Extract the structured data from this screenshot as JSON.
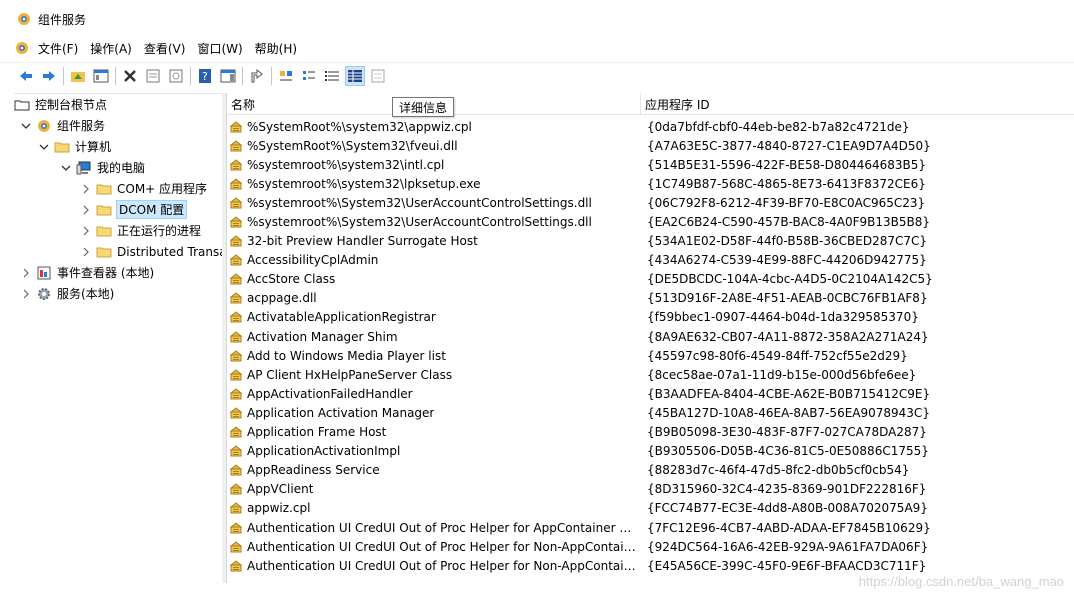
{
  "window": {
    "title": "组件服务"
  },
  "menu": {
    "items": [
      "文件(F)",
      "操作(A)",
      "查看(V)",
      "窗口(W)",
      "帮助(H)"
    ]
  },
  "tooltip": {
    "text": "详细信息"
  },
  "tree": {
    "items": [
      {
        "label": "控制台根节点"
      },
      {
        "label": "组件服务"
      },
      {
        "label": "计算机"
      },
      {
        "label": "我的电脑"
      },
      {
        "label": "COM+ 应用程序"
      },
      {
        "label": "DCOM 配置"
      },
      {
        "label": "正在运行的进程"
      },
      {
        "label": "Distributed Transaction Coordinator"
      },
      {
        "label": "事件查看器 (本地)"
      },
      {
        "label": "服务(本地)"
      }
    ]
  },
  "list": {
    "columns": {
      "name": "名称",
      "appid": "应用程序 ID"
    },
    "rows": [
      {
        "name": "%SystemRoot%\\system32\\appwiz.cpl",
        "appid": "{0da7bfdf-cbf0-44eb-be82-b7a82c4721de}"
      },
      {
        "name": "%SystemRoot%\\System32\\fveui.dll",
        "appid": "{A7A63E5C-3877-4840-8727-C1EA9D7A4D50}"
      },
      {
        "name": "%systemroot%\\system32\\intl.cpl",
        "appid": "{514B5E31-5596-422F-BE58-D804464683B5}"
      },
      {
        "name": "%systemroot%\\system32\\lpksetup.exe",
        "appid": "{1C749B87-568C-4865-8E73-6413F8372CE6}"
      },
      {
        "name": "%systemroot%\\System32\\UserAccountControlSettings.dll",
        "appid": "{06C792F8-6212-4F39-BF70-E8C0AC965C23}"
      },
      {
        "name": "%systemroot%\\System32\\UserAccountControlSettings.dll",
        "appid": "{EA2C6B24-C590-457B-BAC8-4A0F9B13B5B8}"
      },
      {
        "name": "32-bit Preview Handler Surrogate Host",
        "appid": "{534A1E02-D58F-44f0-B58B-36CBED287C7C}"
      },
      {
        "name": "AccessibilityCplAdmin",
        "appid": "{434A6274-C539-4E99-88FC-44206D942775}"
      },
      {
        "name": "AccStore Class",
        "appid": "{DE5DBCDC-104A-4cbc-A4D5-0C2104A142C5}"
      },
      {
        "name": "acppage.dll",
        "appid": "{513D916F-2A8E-4F51-AEAB-0CBC76FB1AF8}"
      },
      {
        "name": "ActivatableApplicationRegistrar",
        "appid": "{f59bbec1-0907-4464-b04d-1da329585370}"
      },
      {
        "name": "Activation Manager Shim",
        "appid": "{8A9AE632-CB07-4A11-8872-358A2A271A24}"
      },
      {
        "name": "Add to Windows Media Player list",
        "appid": "{45597c98-80f6-4549-84ff-752cf55e2d29}"
      },
      {
        "name": "AP Client HxHelpPaneServer Class",
        "appid": "{8cec58ae-07a1-11d9-b15e-000d56bfe6ee}"
      },
      {
        "name": "AppActivationFailedHandler",
        "appid": "{B3AADFEA-8404-4CBE-A62E-B0B715412C9E}"
      },
      {
        "name": "Application Activation Manager",
        "appid": "{45BA127D-10A8-46EA-8AB7-56EA9078943C}"
      },
      {
        "name": "Application Frame Host",
        "appid": "{B9B05098-3E30-483F-87F7-027CA78DA287}"
      },
      {
        "name": "ApplicationActivationImpl",
        "appid": "{B9305506-D05B-4C36-81C5-0E50886C1755}"
      },
      {
        "name": "AppReadiness Service",
        "appid": "{88283d7c-46f4-47d5-8fc2-db0b5cf0cb54}"
      },
      {
        "name": "AppVClient",
        "appid": "{8D315960-32C4-4235-8369-901DF222816F}"
      },
      {
        "name": "appwiz.cpl",
        "appid": "{FCC74B77-EC3E-4dd8-A80B-008A702075A9}"
      },
      {
        "name": "Authentication UI CredUI Out of Proc Helper for AppContainer Clients",
        "appid": "{7FC12E96-4CB7-4ABD-ADAA-EF7845B10629}"
      },
      {
        "name": "Authentication UI CredUI Out of Proc Helper for Non-AppContainer Clients",
        "appid": "{924DC564-16A6-42EB-929A-9A61FA7DA06F}"
      },
      {
        "name": "Authentication UI CredUI Out of Proc Helper for Non-AppContainer Clients",
        "appid": "{E45A56CE-399C-45F0-9E6F-BFAACD3C711F}"
      }
    ]
  },
  "watermark": {
    "text": "https://blog.csdn.net/ba_wang_mao"
  }
}
